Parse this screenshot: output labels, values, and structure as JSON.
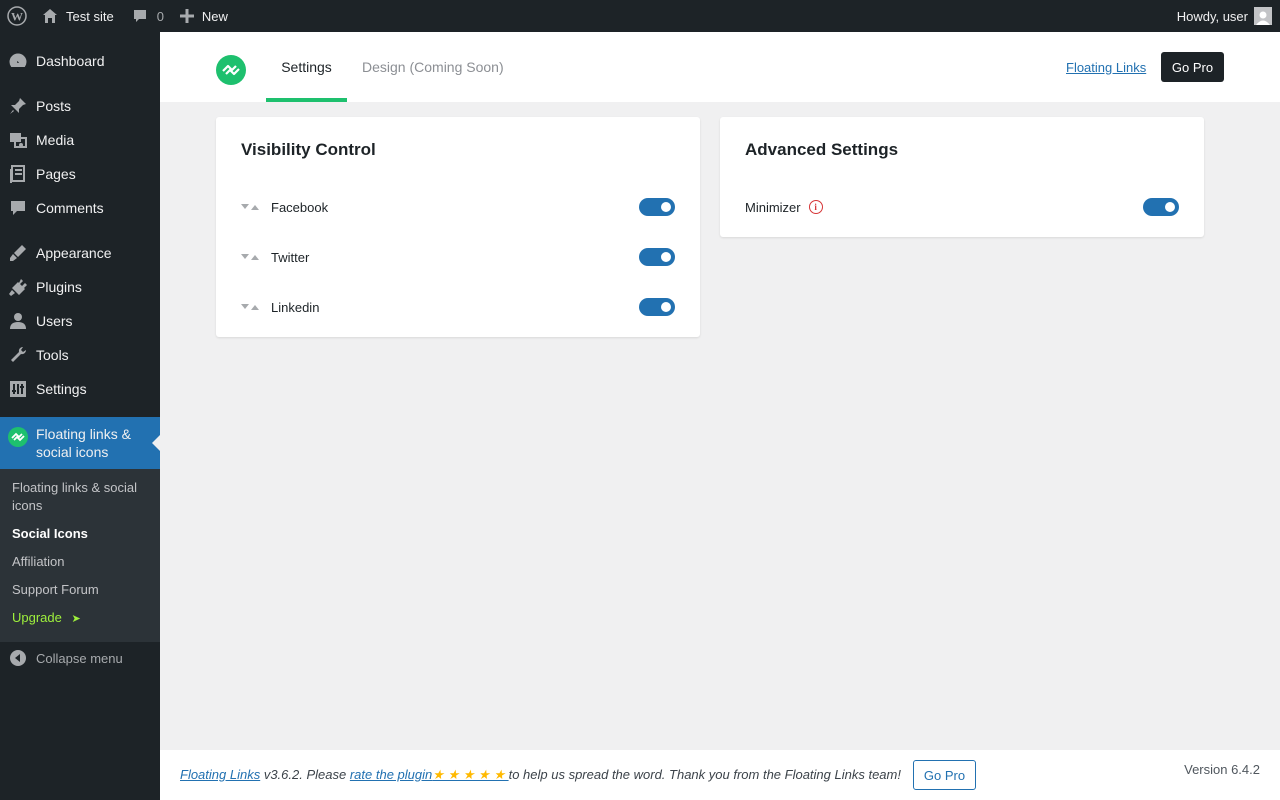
{
  "adminbar": {
    "site_name": "Test site",
    "comments_count": "0",
    "new_label": "New",
    "howdy": "Howdy, user"
  },
  "sidebar": {
    "items": [
      {
        "label": "Dashboard",
        "icon": "dashboard-icon"
      },
      {
        "label": "Posts",
        "icon": "pin-icon"
      },
      {
        "label": "Media",
        "icon": "media-icon"
      },
      {
        "label": "Pages",
        "icon": "pages-icon"
      },
      {
        "label": "Comments",
        "icon": "comment-icon"
      },
      {
        "label": "Appearance",
        "icon": "brush-icon"
      },
      {
        "label": "Plugins",
        "icon": "plug-icon"
      },
      {
        "label": "Users",
        "icon": "user-icon"
      },
      {
        "label": "Tools",
        "icon": "wrench-icon"
      },
      {
        "label": "Settings",
        "icon": "settings-icon"
      }
    ],
    "current": {
      "label": "Floating links & social icons",
      "icon": "floating-links-icon"
    },
    "submenu": [
      {
        "label": "Floating links & social icons"
      },
      {
        "label": "Social Icons"
      },
      {
        "label": "Affiliation"
      },
      {
        "label": "Support Forum"
      },
      {
        "label": "Upgrade",
        "arrow": "➤"
      }
    ],
    "collapse_label": "Collapse menu"
  },
  "header": {
    "tabs": [
      {
        "label": "Settings"
      },
      {
        "label": "Design (Coming Soon)"
      }
    ],
    "link_label": "Floating Links",
    "gopro_label": "Go Pro"
  },
  "visibility": {
    "title": "Visibility Control",
    "rows": [
      {
        "label": "Facebook",
        "enabled": true
      },
      {
        "label": "Twitter",
        "enabled": true
      },
      {
        "label": "Linkedin",
        "enabled": true
      }
    ]
  },
  "advanced": {
    "title": "Advanced Settings",
    "rows": [
      {
        "label": "Minimizer",
        "enabled": true,
        "info_icon": "info-icon"
      }
    ]
  },
  "footer": {
    "link1": "Floating Links",
    "text1": " v3.6.2. Please ",
    "link2": "rate the plugin",
    "stars": "★ ★ ★ ★ ★ ",
    "text2": "to help us spread the word. Thank you from the Floating Links team!",
    "gopro_label": "Go Pro",
    "version": "Version 6.4.2"
  },
  "colors": {
    "accent": "#2271b1",
    "brand_green": "#1ec06e",
    "sidebar_bg": "#1d2327"
  }
}
